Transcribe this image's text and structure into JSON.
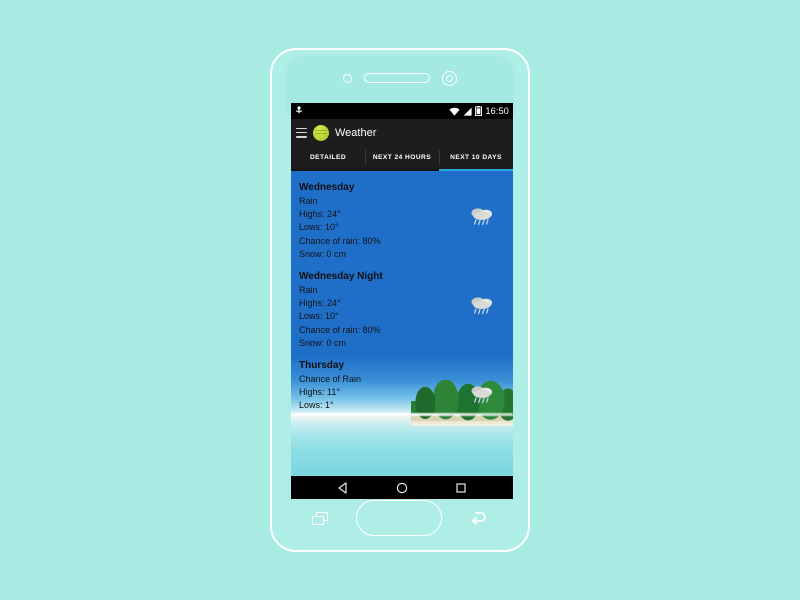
{
  "device": {
    "name": "android-phone-mockup",
    "background_color": "#a7ebe3",
    "body_color": "#aeeee6"
  },
  "status_bar": {
    "time": "16:50",
    "icons": [
      "usb-debug-icon",
      "wifi-icon",
      "signal-icon",
      "battery-icon"
    ]
  },
  "action_bar": {
    "menu_icon": "hamburger-menu-icon",
    "app_icon": "weather-app-icon",
    "title": "Weather"
  },
  "tabs": [
    {
      "label": "DETAILED",
      "active": false
    },
    {
      "label": "NEXT 24 HOURS",
      "active": false
    },
    {
      "label": "NEXT 10 DAYS",
      "active": true
    }
  ],
  "accent_color": "#2aa7e0",
  "forecast": [
    {
      "day": "Wednesday",
      "condition": "Rain",
      "highs": "Highs: 24°",
      "lows": "Lows: 10°",
      "chance": "Chance of rain: 80%",
      "snow": "Snow: 0 cm",
      "icon": "rain-cloud-icon"
    },
    {
      "day": "Wednesday Night",
      "condition": "Rain",
      "highs": "Highs: 24°",
      "lows": "Lows: 10°",
      "chance": "Chance of rain: 80%",
      "snow": "Snow: 0 cm",
      "icon": "rain-cloud-icon"
    },
    {
      "day": "Thursday",
      "condition": "Chance of Rain",
      "highs": "Highs: 11°",
      "lows": "Lows: 1°",
      "chance": "",
      "snow": "",
      "icon": "rain-cloud-icon"
    }
  ],
  "nav_bar": {
    "back": "back-triangle-icon",
    "home": "home-circle-icon",
    "recents": "recents-square-icon"
  },
  "hardware_buttons": {
    "recents": "hw-recents-icon",
    "home": "hw-home-button",
    "back": "hw-back-icon"
  }
}
